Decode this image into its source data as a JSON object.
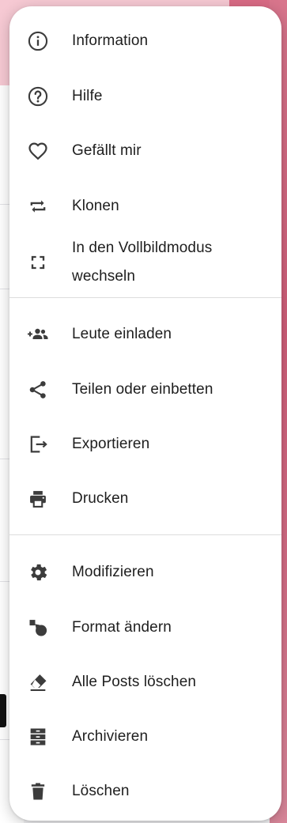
{
  "menu": {
    "items": [
      {
        "label": "Information",
        "icon": "info-icon"
      },
      {
        "label": "Hilfe",
        "icon": "help-icon"
      },
      {
        "label": "Gefällt mir",
        "icon": "heart-icon"
      },
      {
        "label": "Klonen",
        "icon": "repeat-icon"
      },
      {
        "label": "In den Vollbildmodus wechseln",
        "icon": "fullscreen-icon"
      },
      {
        "label": "Leute einladen",
        "icon": "add-people-icon"
      },
      {
        "label": "Teilen oder einbetten",
        "icon": "share-icon"
      },
      {
        "label": "Exportieren",
        "icon": "export-icon"
      },
      {
        "label": "Drucken",
        "icon": "print-icon"
      },
      {
        "label": "Modifizieren",
        "icon": "gear-icon"
      },
      {
        "label": "Format ändern",
        "icon": "format-icon"
      },
      {
        "label": "Alle Posts löschen",
        "icon": "eraser-icon"
      },
      {
        "label": "Archivieren",
        "icon": "archive-icon"
      },
      {
        "label": "Löschen",
        "icon": "trash-icon"
      }
    ]
  },
  "colors": {
    "menu_background": "#ffffff",
    "text": "#1e1e1e",
    "icon": "#3c3c3c",
    "divider": "#dcdcdc",
    "accent_pink": "#d96b85"
  }
}
